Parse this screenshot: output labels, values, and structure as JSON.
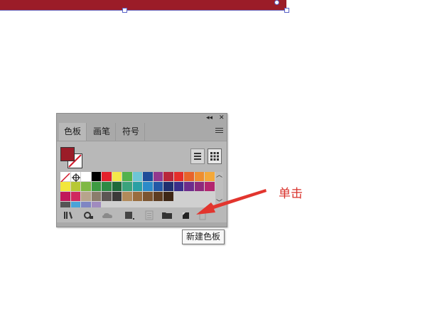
{
  "panel": {
    "tabs": [
      {
        "label": "色板",
        "active": true
      },
      {
        "label": "画笔",
        "active": false
      },
      {
        "label": "符号",
        "active": false
      }
    ],
    "collapse_glyph": "◂◂",
    "close_glyph": "✕",
    "fill_color": "#9b1c28",
    "stroke_color": "none",
    "swatch_rows": [
      [
        "none",
        "registration",
        "#ffffff",
        "#000000",
        "#e3222b",
        "#f4e84a",
        "#53b24c",
        "#6ec5d6",
        "#1f4d99",
        "#93388e",
        "#b9263a",
        "#e52e2b",
        "#e8632a",
        "#ef8e2f",
        "#f4a93a"
      ],
      [
        "#f2e63c",
        "#b7c834",
        "#7fb944",
        "#3d9b42",
        "#2f8a45",
        "#1f6a3a",
        "#3aa37c",
        "#2aa0a4",
        "#2c8bc9",
        "#2358a6",
        "#1f2f6f",
        "#3a2e8a",
        "#6d2c8c",
        "#8e2a7c",
        "#b3266f"
      ],
      [
        "#c1185a",
        "#d0285f",
        "#b7a48c",
        "#8b7d6c",
        "#5d5754",
        "#3c3a39",
        "#b28a5a",
        "#9a6d3e",
        "#7c5531",
        "#5e3d22",
        "#3e2716"
      ],
      [
        "#555555",
        "#4aa3d8",
        "#7f86c3",
        "#a08bbf"
      ]
    ],
    "bottom_icons": [
      "swatch-libraries-icon",
      "show-swatch-kinds-icon",
      "cloud-library-icon",
      "swatch-options-icon",
      "color-group-icon",
      "new-color-group-icon",
      "new-swatch-icon",
      "delete-swatch-icon"
    ]
  },
  "tooltip": {
    "text": "新建色板"
  },
  "annotation": {
    "text": "单击",
    "color": "#d9302a"
  }
}
